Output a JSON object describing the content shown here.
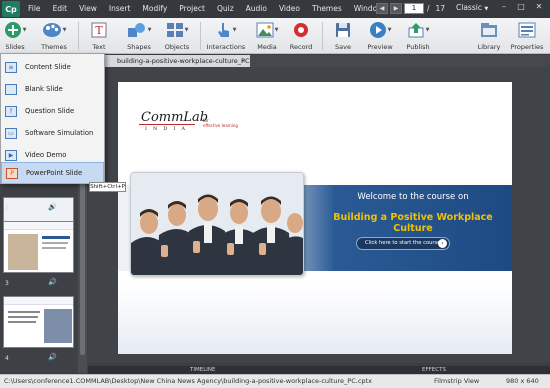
{
  "app": {
    "logo": "Cp",
    "menus": [
      "File",
      "Edit",
      "View",
      "Insert",
      "Modify",
      "Project",
      "Quiz",
      "Audio",
      "Video",
      "Themes",
      "Window"
    ],
    "page_current": "1",
    "page_separator": "/",
    "page_total": "17",
    "workspace": "Classic",
    "window_controls": [
      "–",
      "□",
      "✕"
    ]
  },
  "toolbar": {
    "slides": "Slides",
    "themes": "Themes",
    "text": "Text",
    "shapes": "Shapes",
    "objects": "Objects",
    "interactions": "Interactions",
    "media": "Media",
    "record": "Record",
    "save": "Save",
    "preview": "Preview",
    "publish": "Publish",
    "library": "Library",
    "properties": "Properties"
  },
  "document_tab": {
    "title": "building-a-positive-workplace-culture_PC.cptx*",
    "close": "✕"
  },
  "slide_menu": {
    "items": [
      {
        "label": "Content Slide",
        "icon": "content-slide-icon"
      },
      {
        "label": "Blank Slide",
        "icon": "blank-slide-icon"
      },
      {
        "label": "Question Slide",
        "icon": "question-slide-icon"
      },
      {
        "label": "Software Simulation",
        "icon": "software-simulation-icon"
      },
      {
        "label": "Video Demo",
        "icon": "video-demo-icon"
      },
      {
        "label": "PowerPoint Slide",
        "icon": "powerpoint-slide-icon"
      }
    ],
    "tooltip": "Shift+Ctrl+P"
  },
  "filmstrip": {
    "slides": [
      {
        "number": "2"
      },
      {
        "number": "3"
      },
      {
        "number": "4"
      }
    ],
    "audio_icon": "🔊"
  },
  "slide": {
    "brand": "CommLab",
    "brand_sub": "INDIA",
    "tagline_1": "for",
    "tagline_2": "effective learning",
    "welcome": "Welcome to the course on",
    "course_title": "Building a Positive Workplace Culture",
    "start_button": "Click here to start the course"
  },
  "bottom_tabs": {
    "timeline": "TIMELINE",
    "effects": "EFFECTS"
  },
  "status": {
    "path": "C:\\Users\\conference1.COMMLAB\\Desktop\\New China News Agency\\building-a-positive-workplace-culture_PC.cptx",
    "view": "Filmstrip View",
    "size": "980 x 640"
  },
  "colors": {
    "accent": "#1e7d5e",
    "banner": "#1e4a83",
    "title_yellow": "#f2c200",
    "brand_red": "#c0272d"
  }
}
